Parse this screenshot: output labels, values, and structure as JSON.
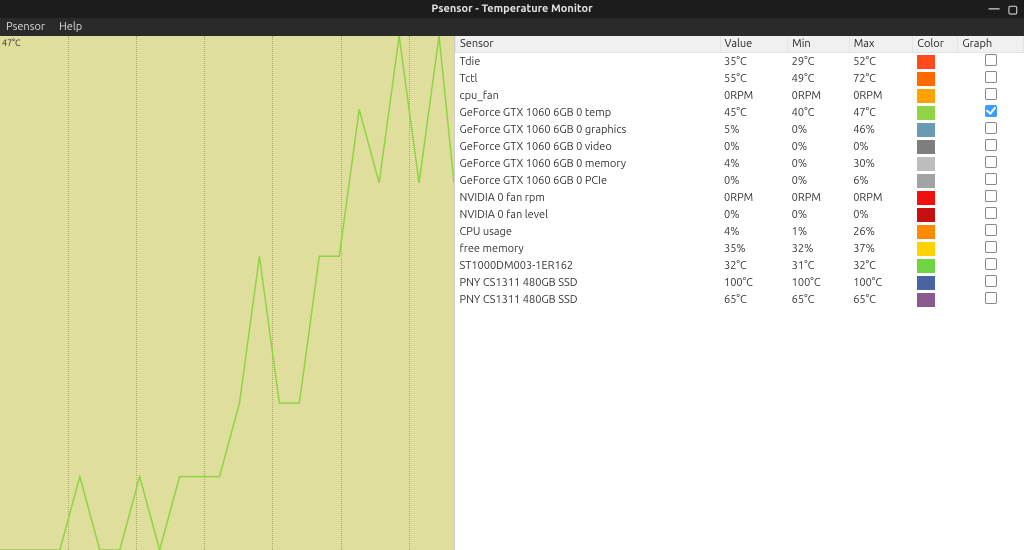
{
  "window": {
    "title": "Psensor - Temperature Monitor"
  },
  "menu": {
    "app": "Psensor",
    "help": "Help"
  },
  "graph": {
    "y_max_label": "47°C"
  },
  "columns": {
    "sensor": "Sensor",
    "value": "Value",
    "min": "Min",
    "max": "Max",
    "color": "Color",
    "graph": "Graph"
  },
  "sensors": [
    {
      "name": "Tdie",
      "value": "35°C",
      "min": "29°C",
      "max": "52°C",
      "color": "#ff4a1c",
      "graph": false
    },
    {
      "name": "Tctl",
      "value": "55°C",
      "min": "49°C",
      "max": "72°C",
      "color": "#ff6a00",
      "graph": false
    },
    {
      "name": "cpu_fan",
      "value": "0RPM",
      "min": "0RPM",
      "max": "0RPM",
      "color": "#ffa200",
      "graph": false
    },
    {
      "name": "GeForce GTX 1060 6GB 0 temp",
      "value": "45°C",
      "min": "40°C",
      "max": "47°C",
      "color": "#8fd445",
      "graph": true
    },
    {
      "name": "GeForce GTX 1060 6GB 0 graphics",
      "value": "5%",
      "min": "0%",
      "max": "46%",
      "color": "#6a9bb5",
      "graph": false
    },
    {
      "name": "GeForce GTX 1060 6GB 0 video",
      "value": "0%",
      "min": "0%",
      "max": "0%",
      "color": "#7e7e7e",
      "graph": false
    },
    {
      "name": "GeForce GTX 1060 6GB 0 memory",
      "value": "4%",
      "min": "0%",
      "max": "30%",
      "color": "#bdbdbd",
      "graph": false
    },
    {
      "name": "GeForce GTX 1060 6GB 0 PCIe",
      "value": "0%",
      "min": "0%",
      "max": "6%",
      "color": "#a3a3a3",
      "graph": false
    },
    {
      "name": "NVIDIA 0 fan rpm",
      "value": "0RPM",
      "min": "0RPM",
      "max": "0RPM",
      "color": "#ef1010",
      "graph": false
    },
    {
      "name": "NVIDIA 0 fan level",
      "value": "0%",
      "min": "0%",
      "max": "0%",
      "color": "#c80f0f",
      "graph": false
    },
    {
      "name": "CPU usage",
      "value": "4%",
      "min": "1%",
      "max": "26%",
      "color": "#ff8a00",
      "graph": false
    },
    {
      "name": "free memory",
      "value": "35%",
      "min": "32%",
      "max": "37%",
      "color": "#ffd200",
      "graph": false
    },
    {
      "name": "ST1000DM003-1ER162",
      "value": "32°C",
      "min": "31°C",
      "max": "32°C",
      "color": "#6fd442",
      "graph": false
    },
    {
      "name": "PNY CS1311 480GB SSD",
      "value": "100°C",
      "min": "100°C",
      "max": "100°C",
      "color": "#4a63a3",
      "graph": false
    },
    {
      "name": "PNY CS1311 480GB SSD",
      "value": "65°C",
      "min": "65°C",
      "max": "65°C",
      "color": "#8a5a8e",
      "graph": false
    }
  ],
  "chart_data": {
    "type": "line",
    "title": "",
    "xlabel": "",
    "ylabel": "",
    "ylim": [
      40,
      47
    ],
    "series": [
      {
        "name": "GeForce GTX 1060 6GB 0 temp",
        "color": "#8fd445",
        "x": [
          0,
          20,
          40,
          60,
          80,
          100,
          120,
          140,
          160,
          180,
          200,
          220,
          240,
          260,
          280,
          300,
          320,
          340,
          360,
          380,
          400,
          420,
          440,
          455
        ],
        "values": [
          40,
          40,
          40,
          40,
          41,
          40,
          40,
          41,
          40,
          41,
          41,
          41,
          42,
          44,
          42,
          42,
          44,
          44,
          46,
          45,
          47,
          45,
          47,
          45
        ]
      }
    ]
  }
}
